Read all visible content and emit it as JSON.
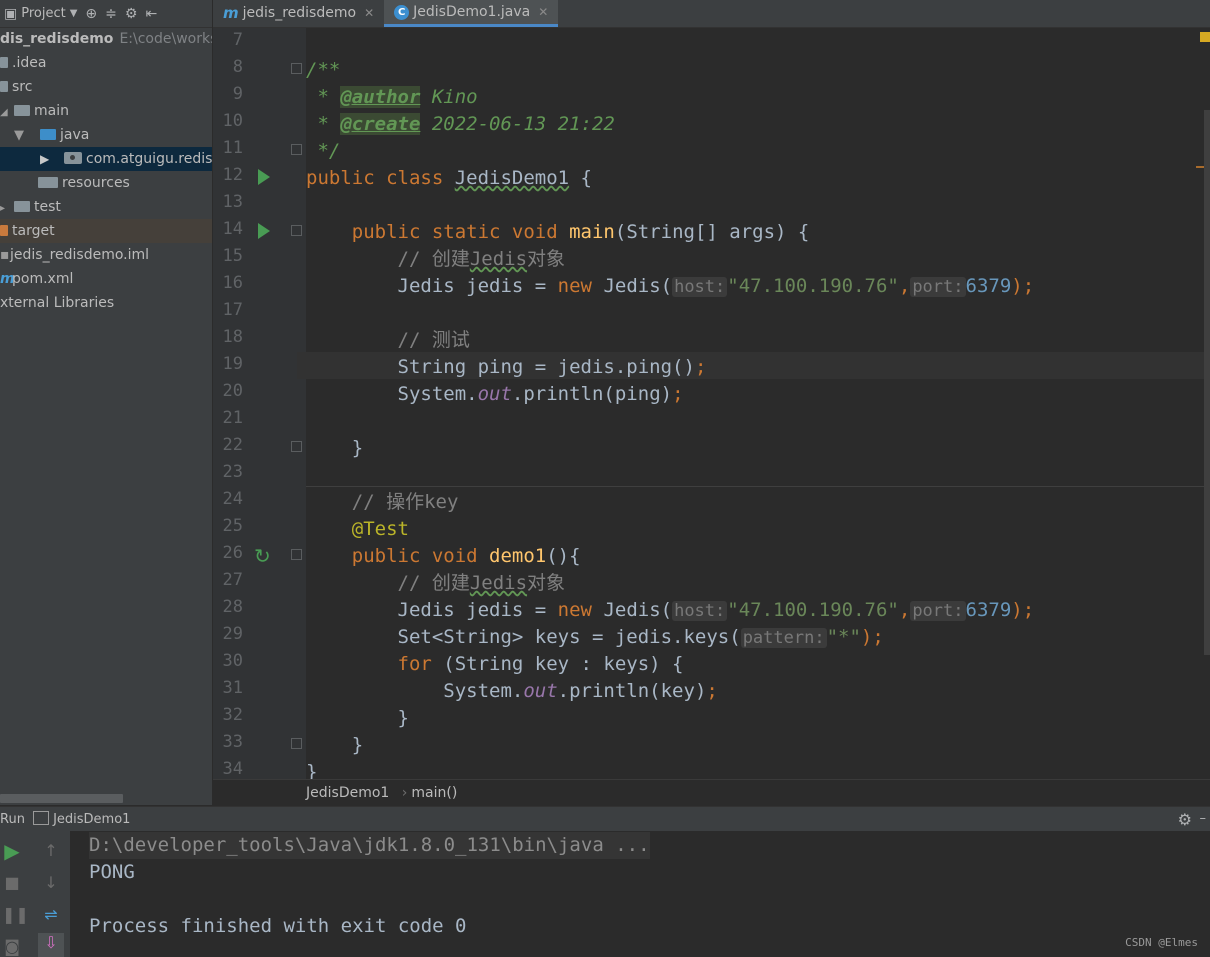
{
  "project_panel": {
    "title": "Project",
    "tree": [
      {
        "label": "dis_redisdemo",
        "extra": "E:\\code\\worksp"
      },
      {
        "label": ".idea"
      },
      {
        "label": "src"
      },
      {
        "label": "main"
      },
      {
        "label": "java"
      },
      {
        "label": "com.atguigu.redis"
      },
      {
        "label": "resources"
      },
      {
        "label": "test"
      },
      {
        "label": "target"
      },
      {
        "label": "jedis_redisdemo.iml"
      },
      {
        "label": "pom.xml"
      },
      {
        "label": "xternal Libraries"
      }
    ]
  },
  "tabs": [
    {
      "icon": "m",
      "label": "jedis_redisdemo"
    },
    {
      "icon": "C",
      "label": "JedisDemo1.java"
    }
  ],
  "editor": {
    "line_numbers": [
      "7",
      "8",
      "9",
      "10",
      "11",
      "12",
      "13",
      "14",
      "15",
      "16",
      "17",
      "18",
      "19",
      "20",
      "21",
      "22",
      "23",
      "24",
      "25",
      "26",
      "27",
      "28",
      "29",
      "30",
      "31",
      "32",
      "33",
      "34"
    ],
    "code": {
      "l8": "/**",
      "l9_star": " * ",
      "l9_tag": "@author",
      "l9_val": " Kino",
      "l10_star": " * ",
      "l10_tag": "@create",
      "l10_val": " 2022-06-13 21:22",
      "l11": " */",
      "l12_kw": "public class ",
      "l12_name": "JedisDemo1",
      "l12_rest": " {",
      "l14_kw": "    public static void ",
      "l14_fn": "main",
      "l14_rest": "(String[] args) {",
      "l15_pre": "        // 创建",
      "l15_sq": "Jedis",
      "l15_post": "对象",
      "l16_a": "        Jedis jedis = ",
      "l16_new": "new",
      "l16_b": " Jedis(",
      "l16_hint1": "host:",
      "l16_str": "\"47.100.190.76\"",
      "l16_comma": ",",
      "l16_hint2": "port:",
      "l16_num": "6379",
      "l16_end": ");",
      "l18": "        // 测试",
      "l19_a": "        String ping = jedis.ping()",
      "l19_end": ";",
      "l20_a": "        System.",
      "l20_field": "out",
      "l20_b": ".println(ping)",
      "l20_end": ";",
      "l22": "    }",
      "l24": "    // 操作key",
      "l25": "    @Test",
      "l26_kw": "    public void ",
      "l26_fn": "demo1",
      "l26_rest": "(){",
      "l27_pre": "        // 创建",
      "l27_sq": "Jedis",
      "l27_post": "对象",
      "l28_a": "        Jedis jedis = ",
      "l28_new": "new",
      "l28_b": " Jedis(",
      "l28_hint1": "host:",
      "l28_str": "\"47.100.190.76\"",
      "l28_comma": ",",
      "l28_hint2": "port:",
      "l28_num": "6379",
      "l28_end": ");",
      "l29_a": "        Set<String> keys = jedis.keys(",
      "l29_hint": "pattern:",
      "l29_str": "\"*\"",
      "l29_end": ");",
      "l30_kw": "        for",
      "l30_rest": " (String key : keys) {",
      "l31_a": "            System.",
      "l31_field": "out",
      "l31_b": ".println(key)",
      "l31_end": ";",
      "l32": "        }",
      "l33": "    }",
      "l34": "}"
    }
  },
  "breadcrumb": {
    "class": "JedisDemo1",
    "sep": "›",
    "method": "main()"
  },
  "run_panel": {
    "label": "Run",
    "config": "JedisDemo1",
    "console": [
      "D:\\developer_tools\\Java\\jdk1.8.0_131\\bin\\java ...",
      "PONG",
      "",
      "Process finished with exit code 0"
    ]
  },
  "watermark": "CSDN @Elmes",
  "colors": {
    "accent": "#4a88c7",
    "run_green": "#499c54",
    "keyword": "#cc7832",
    "string": "#6a8759"
  }
}
